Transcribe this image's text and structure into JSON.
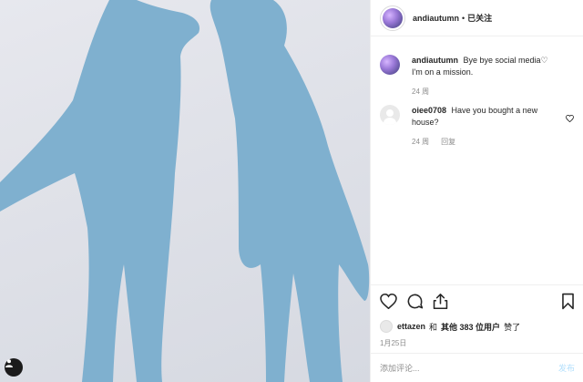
{
  "post": {
    "username": "andiautumn",
    "separator": "•",
    "follow_status": "已关注"
  },
  "comments": [
    {
      "username": "andiautumn",
      "text": "Bye bye social media♡ I'm on a mission.",
      "time": "24 周",
      "reply": ""
    },
    {
      "username": "oiee0708",
      "text": "Have you bought a new house?",
      "time": "24 周",
      "reply": "回复"
    }
  ],
  "likes": {
    "first_user": "ettazen",
    "text_and": "和",
    "text_others": "其他 383 位用户",
    "text_liked": "赞了"
  },
  "date": "1月25日",
  "add_comment": {
    "placeholder": "添加评论...",
    "post_label": "发布"
  },
  "icons": {
    "heart": "heart-icon",
    "comment": "comment-icon",
    "share": "share-icon",
    "bookmark": "bookmark-icon",
    "tag": "user-tag-icon"
  },
  "colors": {
    "shadow": "#7fb0cf",
    "ground": "#e3e5eb",
    "post_button": "#b2dffc",
    "meta_text": "#8e8e8e"
  }
}
